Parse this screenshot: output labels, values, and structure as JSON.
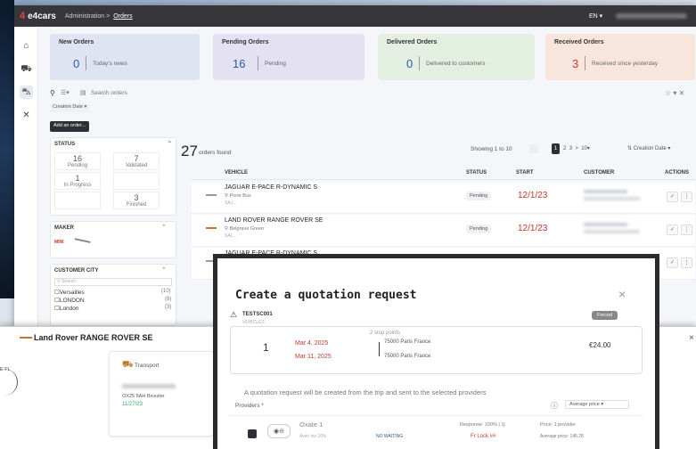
{
  "app": {
    "logo": "e4cars",
    "breadcrumb_admin": "Administration",
    "breadcrumb_sep": ">",
    "breadcrumb_current": "Orders",
    "lang": "EN"
  },
  "cards": [
    {
      "title": "New Orders",
      "count": "0",
      "sub": "Today's news",
      "color": "#dfe4f3"
    },
    {
      "title": "Pending Orders",
      "count": "16",
      "sub": "Pending",
      "color": "#e4e1f3"
    },
    {
      "title": "Delivered Orders",
      "count": "0",
      "sub": "Delivered to customers",
      "color": "#e3efe0"
    },
    {
      "title": "Received Orders",
      "count": "3",
      "sub": "Received since yesterday",
      "color": "#f8e6dc"
    }
  ],
  "search": {
    "placeholder": "Search orders"
  },
  "sort_chip": "Creation Date",
  "add_order": "Add an order...",
  "status_panel": {
    "title": "STATUS",
    "items": [
      {
        "value": "16",
        "label": "Pending"
      },
      {
        "value": "7",
        "label": "Validated"
      },
      {
        "value": "1",
        "label": "In Progress"
      },
      {
        "value": "",
        "label": ""
      },
      {
        "value": "",
        "label": ""
      },
      {
        "value": "3",
        "label": "Finished"
      }
    ]
  },
  "maker_panel": {
    "title": "MAKER"
  },
  "city_panel": {
    "title": "CUSTOMER CITY",
    "search": "Search",
    "cities": [
      {
        "name": "Versailles",
        "count": "(10)"
      },
      {
        "name": "LONDON",
        "count": "(8)"
      },
      {
        "name": "London",
        "count": "(3)"
      }
    ]
  },
  "orders": {
    "count": "27",
    "count_label": "orders found",
    "showing": "Showing 1 to 10",
    "pages": [
      "1",
      "2",
      "3",
      ">",
      "10"
    ],
    "sort": "Creation Date",
    "columns": {
      "vehicle": "VEHICLE",
      "status": "STATUS",
      "start": "START",
      "customer": "CUSTOMER",
      "actions": "ACTIONS"
    },
    "rows": [
      {
        "vehicle": "JAGUAR E-PACE R-DYNAMIC S",
        "location": "Porte Bus",
        "vin": "SAJ...",
        "status": "Pending",
        "start": "12/1/23"
      },
      {
        "vehicle": "LAND ROVER RANGE ROVER SE",
        "location": "Belgrave Green",
        "vin": "SAL...",
        "status": "Pending",
        "start": "12/1/23"
      },
      {
        "vehicle": "JAGUAR E-PACE R-DYNAMIC S",
        "location": "",
        "vin": "",
        "status": "",
        "start": ""
      }
    ]
  },
  "detail": {
    "title": "Land Rover RANGE ROVER SE",
    "transport": "Transport",
    "address": "OX25 5AH Bicester",
    "date": "11/27/23",
    "left_edge": "E FL"
  },
  "modal": {
    "title": "Create a quotation request",
    "vehicle_label": "TESTSC001",
    "vehicle_sub": "VEHICLES",
    "badge": "Forced",
    "trip_index": "1",
    "stops": "2 stop points",
    "date_from": "Mar 4, 2025",
    "date_to": "Mar 11, 2025",
    "place_from": "75000 Paris France",
    "place_to": "75000 Paris France",
    "price": "€24.00",
    "info": "A quotation request will be created from the trip and sent to the selected providers",
    "providers_label": "Providers *",
    "sort": "Average price",
    "provider_name": "Oxate 1",
    "provider_sub": "Avec Inc 10%",
    "provider_col2": "Response: 100% | 1j",
    "provider_col3": "Price: 1 provider",
    "provider_note": "NO WAITING",
    "provider_price": "Fr Lock ##",
    "provider_avg": "Average price: 145.28",
    "close": "×"
  },
  "colors": {
    "accent": "#2c5aa0",
    "date": "#c0392b",
    "topbar": "#37373b"
  }
}
